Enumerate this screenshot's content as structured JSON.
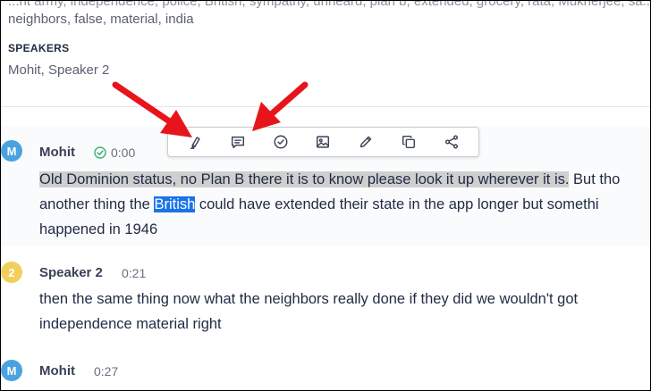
{
  "keywords": {
    "partial_line": "...nt army, independence, police, British, sympathy, unheard, plan b, extended, grocery, rata, Mukherjee, sa...",
    "line": "neighbors, false, material, india"
  },
  "speakers_section": {
    "heading": "SPEAKERS",
    "value": "Mohit, Speaker 2"
  },
  "toolbar": {
    "icons": [
      "highlighter-icon",
      "comment-icon",
      "check-circle-icon",
      "image-icon",
      "pencil-icon",
      "copy-icon",
      "share-icon"
    ]
  },
  "transcript": [
    {
      "avatar": "M",
      "avatar_color": "#4aa3df",
      "speaker": "Mohit",
      "time": "0:00",
      "verified": true,
      "line1": "Old Dominion status, no Plan B there it is to know please look it up wherever it is.",
      "line1_rest": " But tho",
      "line2_before": "another thing the ",
      "line2_selected": "British",
      "line2_after": " could have extended their state in the app longer but somethi",
      "line3": "happened in 1946"
    },
    {
      "avatar": "2",
      "avatar_color": "#f2cf5b",
      "speaker": "Speaker 2",
      "time": "0:21",
      "line1": "then the same thing now what the neighbors really done if they did we wouldn't got",
      "line2": "independence material right"
    },
    {
      "avatar": "M",
      "avatar_color": "#4aa3df",
      "speaker": "Mohit",
      "time": "0:27"
    }
  ],
  "colors": {
    "selection": "#1a73e8",
    "highlight": "#cfcfcf",
    "arrow": "#e8141b",
    "check": "#3bb273"
  }
}
